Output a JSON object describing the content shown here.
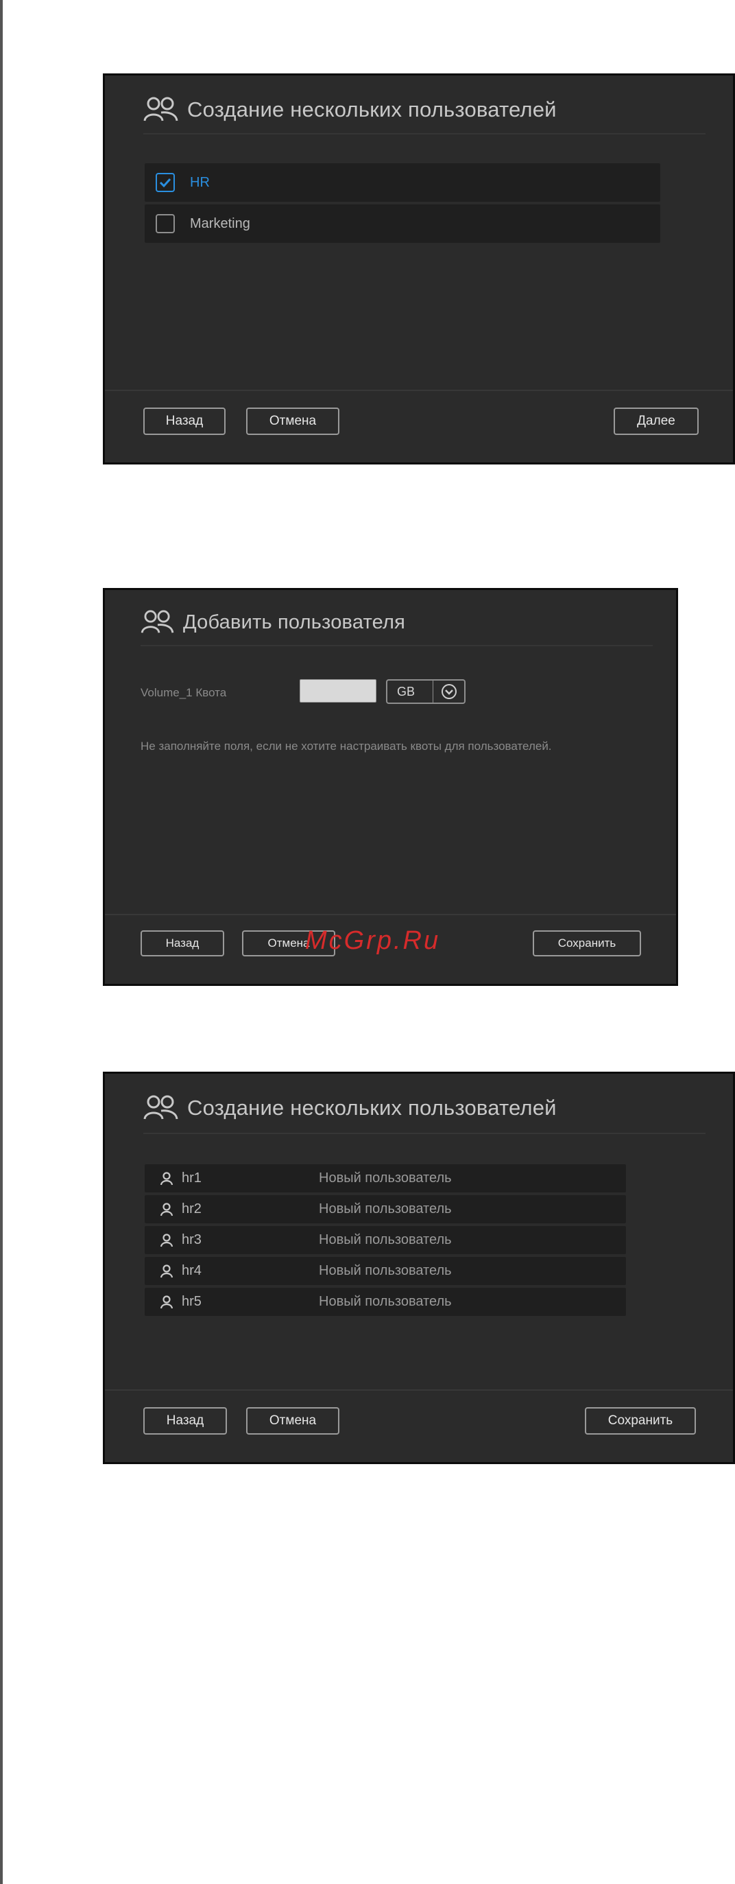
{
  "dialog1": {
    "title": "Создание нескольких пользователей",
    "title_icon": "users-icon",
    "items": [
      {
        "label": "HR",
        "checked": true
      },
      {
        "label": "Marketing",
        "checked": false
      }
    ],
    "buttons": {
      "back": "Назад",
      "cancel": "Отмена",
      "next": "Далее"
    }
  },
  "dialog2": {
    "title": "Добавить пользователя",
    "title_icon": "users-icon",
    "quota_label": "Volume_1 Квота",
    "quota_value": "",
    "unit_value": "GB",
    "hint": "Не заполняйте поля, если не хотите настраивать квоты для пользователей.",
    "buttons": {
      "back": "Назад",
      "cancel": "Отмена",
      "save": "Сохранить"
    },
    "watermark": "McGrp.Ru"
  },
  "dialog3": {
    "title": "Создание нескольких пользователей",
    "title_icon": "users-icon",
    "users": [
      {
        "name": "hr1",
        "description": "Новый пользователь"
      },
      {
        "name": "hr2",
        "description": "Новый пользователь"
      },
      {
        "name": "hr3",
        "description": "Новый пользователь"
      },
      {
        "name": "hr4",
        "description": "Новый пользователь"
      },
      {
        "name": "hr5",
        "description": "Новый пользователь"
      }
    ],
    "buttons": {
      "back": "Назад",
      "cancel": "Отмена",
      "save": "Сохранить"
    }
  },
  "colors": {
    "accent": "#2a8fe0",
    "dialog_bg": "#2b2b2b",
    "row_bg": "#1f1f1f",
    "watermark": "#d62b2b"
  }
}
